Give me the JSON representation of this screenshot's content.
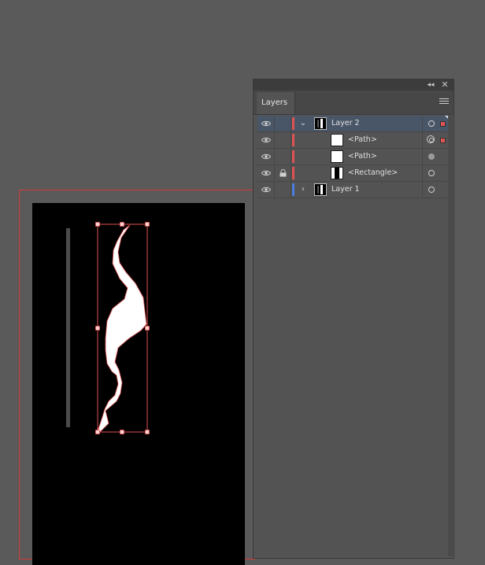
{
  "panel": {
    "tab_label": "Layers",
    "collapse_glyph": "◂◂",
    "close_glyph": "✕",
    "menu_icon": "hamburger-menu-icon"
  },
  "layers": [
    {
      "name": "Layer 2",
      "indent": 0,
      "expanded": true,
      "selected": true,
      "visible": true,
      "locked": false,
      "color": "#e05252",
      "thumb": "layer2-thumb",
      "target": "ring",
      "selection": "square"
    },
    {
      "name": "<Path>",
      "indent": 1,
      "selected": false,
      "visible": true,
      "locked": false,
      "color": "#e05252",
      "thumb": "white",
      "target": "double-ring",
      "selection": "square"
    },
    {
      "name": "<Path>",
      "indent": 1,
      "selected": false,
      "visible": true,
      "locked": false,
      "color": "#e05252",
      "thumb": "white",
      "target": "filled",
      "selection": "none"
    },
    {
      "name": "<Rectangle>",
      "indent": 1,
      "selected": false,
      "visible": true,
      "locked": true,
      "color": "#e05252",
      "thumb": "black-bar",
      "target": "ring",
      "selection": "none"
    },
    {
      "name": "Layer 1",
      "indent": 0,
      "expanded": false,
      "selected": false,
      "visible": true,
      "locked": false,
      "color": "#4a7ee0",
      "thumb": "layer1-thumb",
      "target": "ring",
      "selection": "none"
    }
  ],
  "colors": {
    "canvas_bg": "#5a5a5a",
    "artboard": "#000000",
    "selection_red": "#e05252",
    "layer1_blue": "#4a7ee0"
  }
}
